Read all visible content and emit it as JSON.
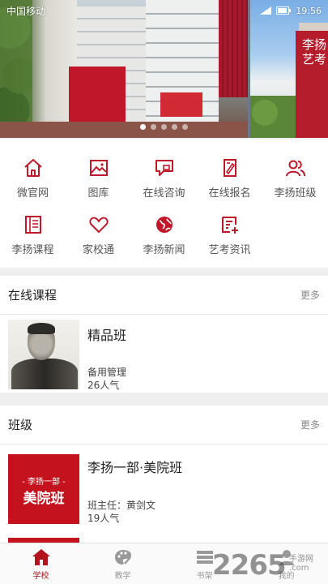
{
  "status_bar": {
    "carrier": "中国移动",
    "time": "19:56"
  },
  "banner": {
    "slide_logo_text": "李扬艺考",
    "dots_count": 5,
    "active_dot": 0
  },
  "menu": {
    "items": [
      {
        "label": "微官网",
        "icon": "home-icon"
      },
      {
        "label": "图库",
        "icon": "image-icon"
      },
      {
        "label": "在线咨询",
        "icon": "chat-icon"
      },
      {
        "label": "在线报名",
        "icon": "edit-form-icon"
      },
      {
        "label": "李扬班级",
        "icon": "users-icon"
      },
      {
        "label": "李扬课程",
        "icon": "book-icon"
      },
      {
        "label": "家校通",
        "icon": "heart-icon"
      },
      {
        "label": "李扬新闻",
        "icon": "globe-icon"
      },
      {
        "label": "艺考资讯",
        "icon": "list-add-icon"
      }
    ]
  },
  "online_courses": {
    "title": "在线课程",
    "more": "更多",
    "items": [
      {
        "name": "精品班",
        "teacher": "备用管理",
        "popularity": "26人气"
      }
    ]
  },
  "classes": {
    "title": "班级",
    "more": "更多",
    "items": [
      {
        "name": "李扬一部·美院班",
        "thumb_line1": "- 李扬一部 -",
        "thumb_line2": "美院班",
        "teacher": "班主任：黄剑文",
        "popularity": "19人气"
      }
    ]
  },
  "tabbar": {
    "items": [
      {
        "label": "学校",
        "icon": "school-icon",
        "active": true
      },
      {
        "label": "教学",
        "icon": "palette-icon",
        "active": false
      },
      {
        "label": "书架",
        "icon": "bookshelf-icon",
        "active": false
      },
      {
        "label": "我的",
        "icon": "person-icon",
        "active": false
      }
    ]
  },
  "watermark": {
    "text": "2265",
    "line1": "手游网",
    "line2": ".com"
  },
  "colors": {
    "accent": "#b3121f",
    "icon_red": "#c0182a"
  }
}
